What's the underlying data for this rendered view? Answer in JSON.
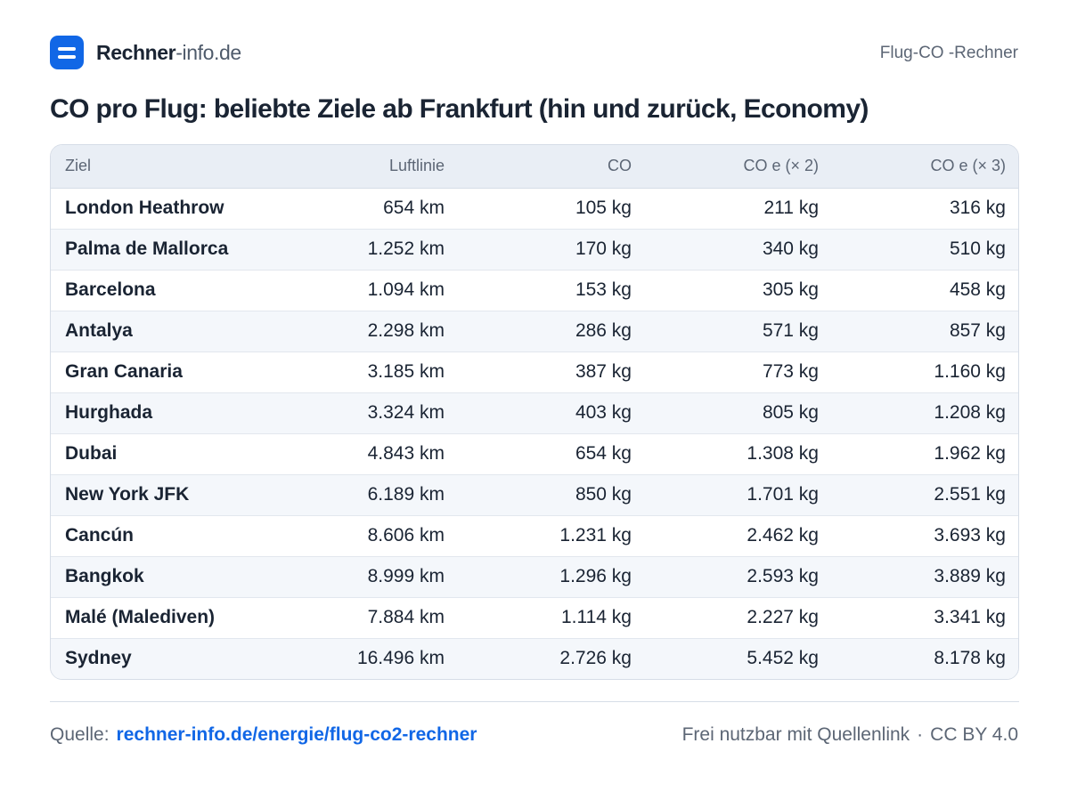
{
  "header": {
    "brand_strong": "Rechner",
    "brand_light": "-info.de",
    "right_label": "Flug-CO -Rechner",
    "logo_icon": "equals-icon",
    "accent_color": "#1167e6"
  },
  "title": "CO  pro Flug: beliebte Ziele ab Frankfurt (hin und zurück, Economy)",
  "table": {
    "columns": [
      "Ziel",
      "Luftlinie",
      "CO",
      "CO e (× 2)",
      "CO e (× 3)"
    ],
    "rows": [
      [
        "London Heathrow",
        "654 km",
        "105 kg",
        "211 kg",
        "316 kg"
      ],
      [
        "Palma de Mallorca",
        "1.252 km",
        "170 kg",
        "340 kg",
        "510 kg"
      ],
      [
        "Barcelona",
        "1.094 km",
        "153 kg",
        "305 kg",
        "458 kg"
      ],
      [
        "Antalya",
        "2.298 km",
        "286 kg",
        "571 kg",
        "857 kg"
      ],
      [
        "Gran Canaria",
        "3.185 km",
        "387 kg",
        "773 kg",
        "1.160 kg"
      ],
      [
        "Hurghada",
        "3.324 km",
        "403 kg",
        "805 kg",
        "1.208 kg"
      ],
      [
        "Dubai",
        "4.843 km",
        "654 kg",
        "1.308 kg",
        "1.962 kg"
      ],
      [
        "New York JFK",
        "6.189 km",
        "850 kg",
        "1.701 kg",
        "2.551 kg"
      ],
      [
        "Cancún",
        "8.606 km",
        "1.231 kg",
        "2.462 kg",
        "3.693 kg"
      ],
      [
        "Bangkok",
        "8.999 km",
        "1.296 kg",
        "2.593 kg",
        "3.889 kg"
      ],
      [
        "Malé (Malediven)",
        "7.884 km",
        "1.114 kg",
        "2.227 kg",
        "3.341 kg"
      ],
      [
        "Sydney",
        "16.496 km",
        "2.726 kg",
        "5.452 kg",
        "8.178 kg"
      ]
    ]
  },
  "footer": {
    "source_label": "Quelle:",
    "source_link": "rechner-info.de/energie/flug-co2-rechner",
    "license_text": "Frei nutzbar mit Quellenlink",
    "separator": "·",
    "license_name": "CC BY 4.0"
  }
}
